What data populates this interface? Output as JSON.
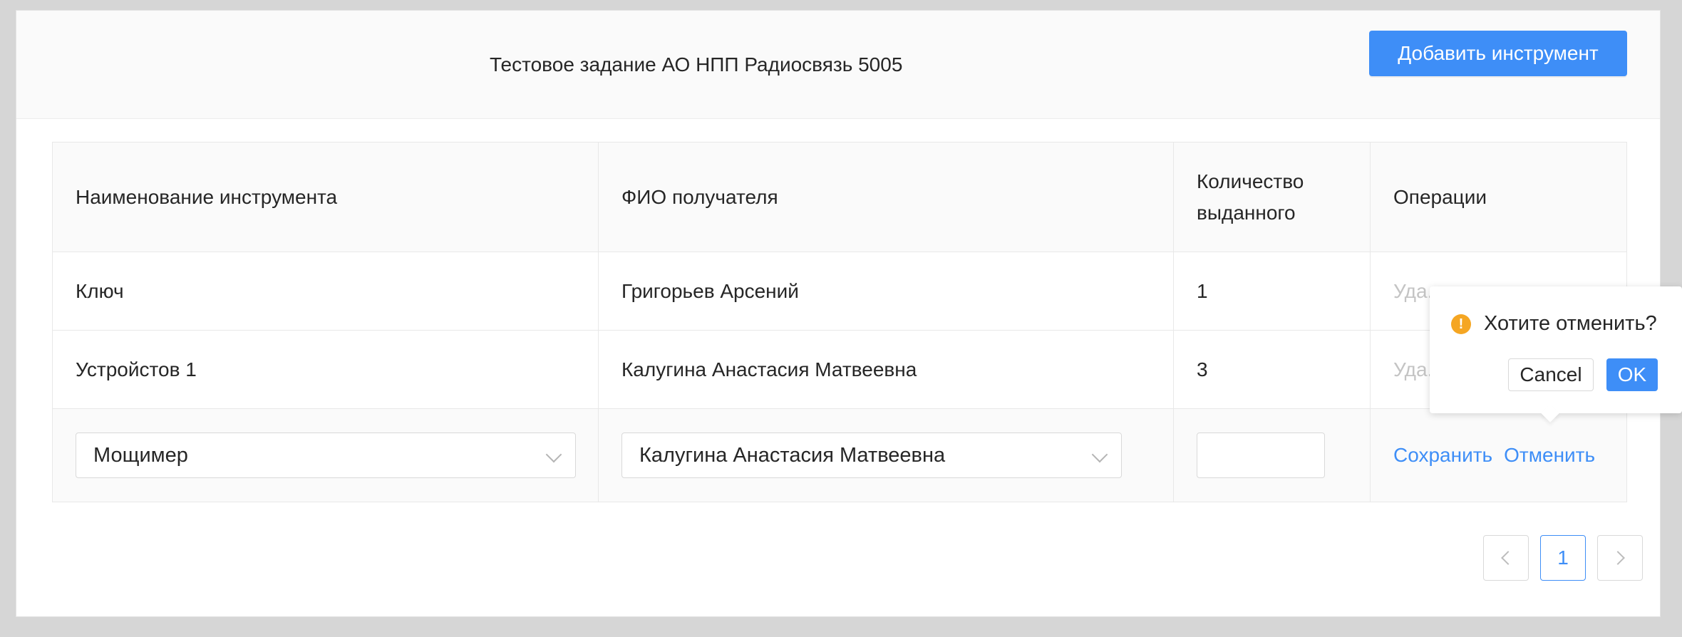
{
  "header": {
    "title": "Тестовое задание АО НПП Радиосвязь 5005",
    "add_button_label": "Добавить инструмент"
  },
  "table": {
    "columns": [
      "Наименование инструмента",
      "ФИО получателя",
      "Количество выданного",
      "Операции"
    ],
    "rows": [
      {
        "tool": "Ключ",
        "recipient": "Григорьев Арсений",
        "quantity": "1",
        "operation": "Уда..."
      },
      {
        "tool": "Устройстов 1",
        "recipient": "Калугина Анастасия Матвеевна",
        "quantity": "3",
        "operation": "Уда..."
      }
    ],
    "edit_row": {
      "tool_value": "Мощимер",
      "recipient_value": "Калугина Анастасия Матвеевна",
      "quantity_value": "",
      "save_label": "Сохранить",
      "cancel_label": "Отменить"
    }
  },
  "popconfirm": {
    "message": "Хотите отменить?",
    "icon": "exclamation-circle-icon",
    "icon_glyph": "!",
    "cancel_label": "Cancel",
    "ok_label": "OK"
  },
  "pagination": {
    "current_page": "1"
  },
  "colors": {
    "primary": "#3e8ef7",
    "warning": "#f5a623",
    "background": "#d6d6d6"
  }
}
